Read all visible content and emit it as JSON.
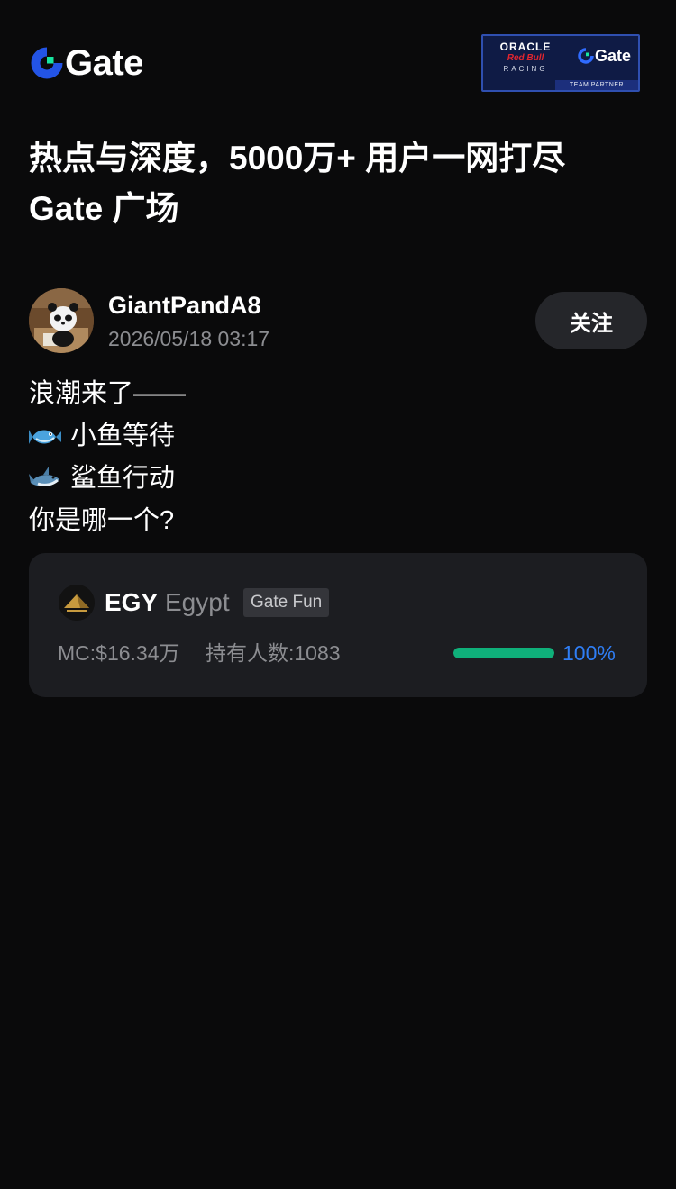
{
  "header": {
    "brand": "Gate",
    "partner": {
      "oracle": "ORACLE",
      "redbull": "Red Bull",
      "racing": "RACING",
      "gate": "Gate",
      "team_partner": "TEAM PARTNER"
    }
  },
  "headline": {
    "line1": "热点与深度，5000万+ 用户一网打尽",
    "line2": "Gate 广场"
  },
  "post": {
    "author": "GiantPandA8",
    "timestamp": "2026/05/18 03:17",
    "follow_label": "关注",
    "lines": [
      {
        "emoji": "",
        "text": "浪潮来了——"
      },
      {
        "emoji": "fish-icon",
        "text": "小鱼等待"
      },
      {
        "emoji": "shark-icon",
        "text": "鲨鱼行动"
      },
      {
        "emoji": "",
        "text": "你是哪一个?"
      }
    ]
  },
  "token": {
    "symbol": "EGY",
    "name": "Egypt",
    "tag": "Gate Fun",
    "market_cap": "MC:$16.34万",
    "holders": "持有人数:1083",
    "progress": 1.0,
    "progress_label": "100%",
    "colors": {
      "progress": "#0fb07a",
      "progress_text": "#2f7ef5"
    }
  }
}
